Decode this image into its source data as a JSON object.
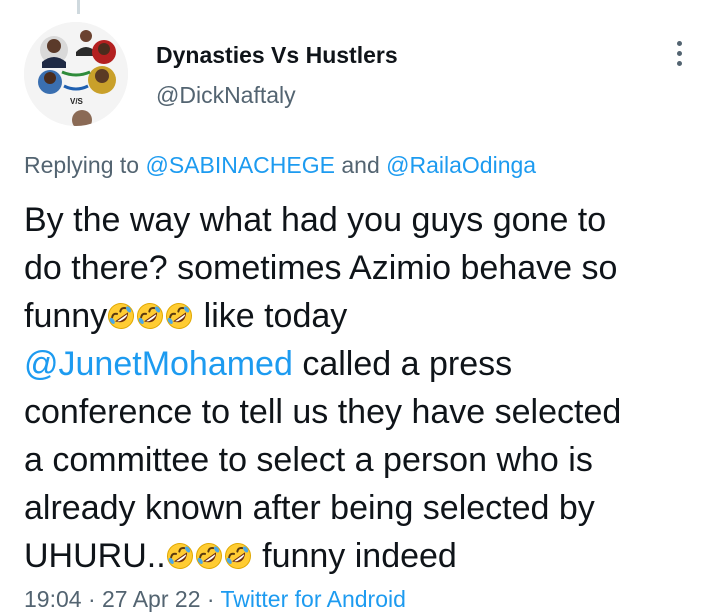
{
  "tweet": {
    "author_name": "Dynasties Vs Hustlers",
    "author_handle": "@DickNaftaly",
    "avatar_text": "V/S",
    "replying_prefix": "Replying to",
    "reply_to_1": "@SABINACHEGE",
    "reply_joiner": "and",
    "reply_to_2": "@RailaOdinga",
    "text": {
      "line1": "By the way what had you guys gone to",
      "line2": "do there? sometimes Azimio behave so",
      "line3_a": "funny",
      "line3_b": " like today",
      "line4_mention": "@JunetMohamed",
      "line4_rest": " called a press",
      "line5": "conference to tell us they have selected",
      "line6": "a committee to select a person who is",
      "line7": "already known after being selected by",
      "line8_a": "UHURU..",
      "line8_b": " funny indeed"
    },
    "time": "19:04",
    "separator": "·",
    "date": "27 Apr 22",
    "source": "Twitter for Android",
    "emoji_name": "rolling-on-the-floor-laughing"
  },
  "colors": {
    "text": "#0f1419",
    "secondary": "#536471",
    "link": "#1d9bf0"
  }
}
